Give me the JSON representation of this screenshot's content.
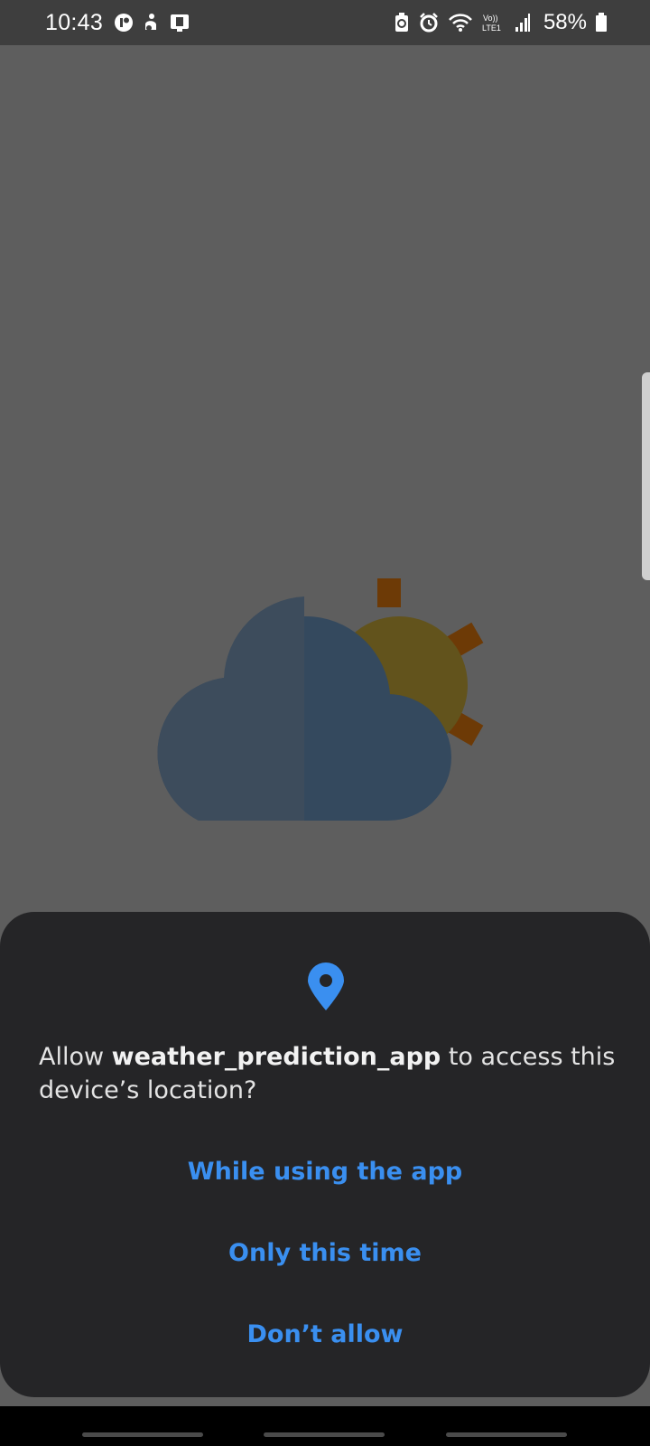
{
  "status_bar": {
    "time": "10:43",
    "battery_percent": "58%",
    "left_icons": [
      "app-notification-icon",
      "accessibility-icon",
      "device-icon"
    ],
    "right_icons": [
      "battery-saver-icon",
      "alarm-icon",
      "wifi-icon",
      "volte-lte-icon",
      "signal-icon",
      "battery-icon"
    ],
    "network_label": "Vo)) LTE1"
  },
  "permission_dialog": {
    "icon": "location-pin-icon",
    "message_prefix": "Allow ",
    "app_name": "weather_prediction_app",
    "message_suffix": " to access this device’s location?",
    "buttons": {
      "while_using": "While using the app",
      "only_this_time": "Only this time",
      "dont_allow": "Don’t allow"
    },
    "accent_color": "#3a8ff0"
  },
  "illustration": {
    "icon": "partly-cloudy-icon"
  }
}
